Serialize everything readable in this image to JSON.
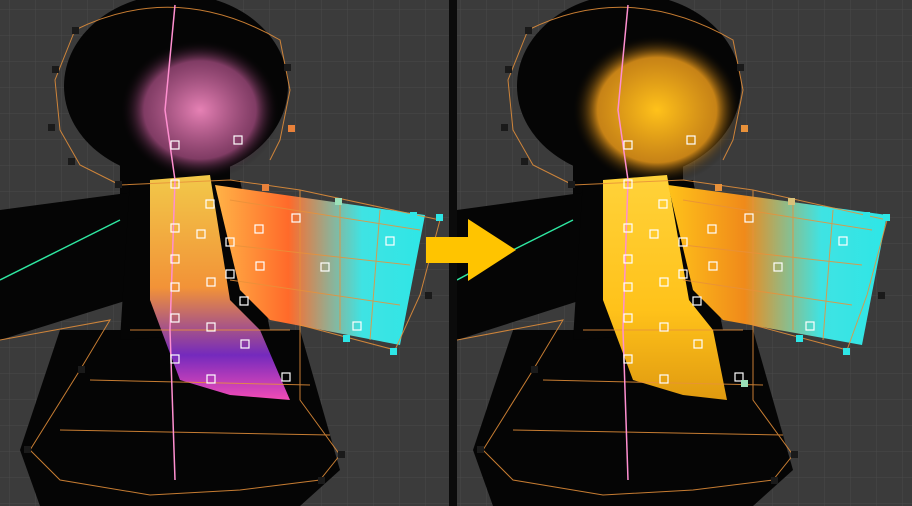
{
  "app": {
    "view": "weight-paint-comparison",
    "viewport_background": "#3b3b3b",
    "grid_color": "#4a4a4a",
    "divider_color": "#0b0b0b"
  },
  "panels": [
    {
      "id": "before",
      "weight_colors": [
        "#ff6fa8",
        "#ffb347",
        "#7a2cc7",
        "#ff4fbf",
        "#2ee6e6"
      ]
    },
    {
      "id": "after",
      "weight_colors": [
        "#ffc21a",
        "#f7a21b",
        "#ffd23a",
        "#2ee6e6"
      ]
    }
  ],
  "arrow": {
    "icon": "right-arrow-icon",
    "color": "#ffc400"
  },
  "overlay_colors": {
    "mesh_wire": "#e8913a",
    "control_point": "#1a1a1a",
    "selected_vertex": "#ffffff",
    "bone_line": "#ff8fd0"
  }
}
